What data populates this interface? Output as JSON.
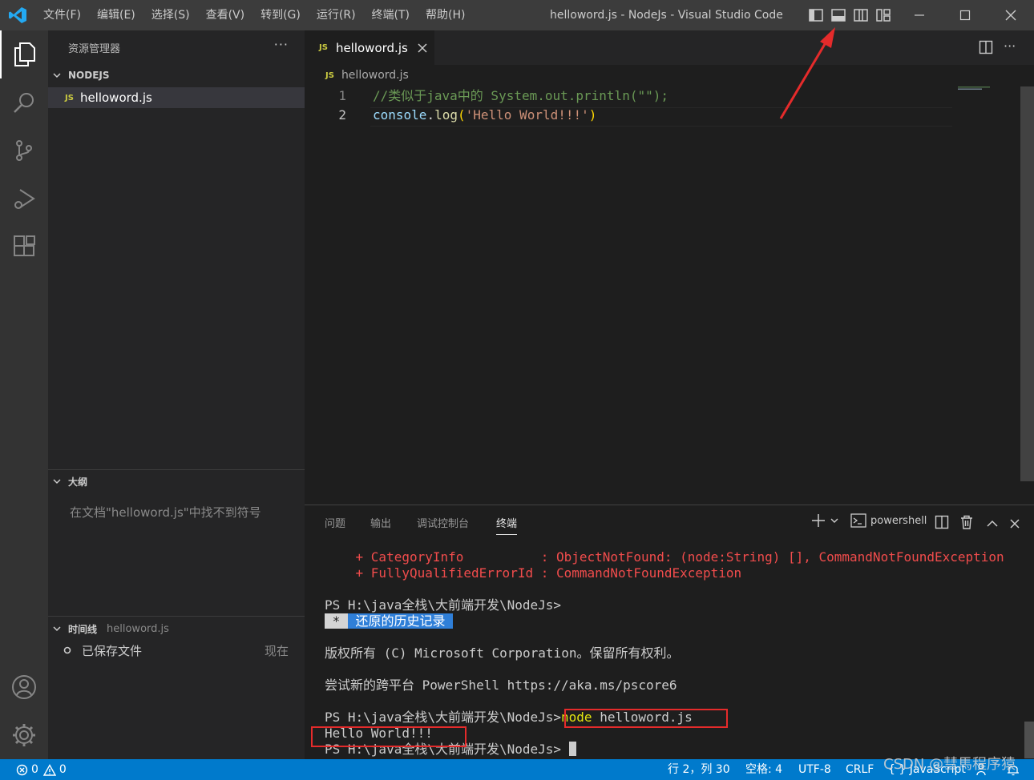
{
  "titlebar": {
    "menu": [
      "文件(F)",
      "编辑(E)",
      "选择(S)",
      "查看(V)",
      "转到(G)",
      "运行(R)",
      "终端(T)",
      "帮助(H)"
    ],
    "title": "helloword.js - NodeJs - Visual Studio Code"
  },
  "sidebar": {
    "title": "资源管理器",
    "more": "···",
    "folder": "NODEJS",
    "file": "helloword.js",
    "file_badge": "JS",
    "outline": {
      "title": "大纲",
      "empty_message": "在文档\"helloword.js\"中找不到符号"
    },
    "timeline": {
      "title": "时间线",
      "file": "helloword.js",
      "entry_label": "已保存文件",
      "entry_time": "现在"
    }
  },
  "editor": {
    "tab_label": "helloword.js",
    "tab_badge": "JS",
    "breadcrumb": "helloword.js",
    "lines": [
      {
        "num": "1",
        "comment": "//类似于java中的 System.out.println(\"\");"
      },
      {
        "num": "2",
        "obj": "console",
        "dot": ".",
        "method": "log",
        "open": "(",
        "str": "'Hello World!!!'",
        "close": ")"
      }
    ]
  },
  "panel": {
    "tabs": [
      "问题",
      "输出",
      "调试控制台",
      "终端"
    ],
    "active_tab": "终端",
    "shell": "powershell",
    "terminal": {
      "err1": "    + CategoryInfo          : ObjectNotFound: (node:String) [], CommandNotFoundException",
      "err2": "    + FullyQualifiedErrorId : CommandNotFoundException",
      "prompt1": "PS H:\\java全栈\\大前端开发\\NodeJs>",
      "restore_star": " * ",
      "restore_text": " 还原的历史记录 ",
      "copyright": "版权所有 (C) Microsoft Corporation。保留所有权利。",
      "pscore": "尝试新的跨平台 PowerShell https://aka.ms/pscore6",
      "prompt2": "PS H:\\java全栈\\大前端开发\\NodeJs>",
      "cmd_node": "node",
      "cmd_rest": " helloword.js",
      "output": "Hello World!!!",
      "prompt3": "PS H:\\java全栈\\大前端开发\\NodeJs>"
    }
  },
  "statusbar": {
    "errors": "0",
    "warnings": "0",
    "position": "行 2，列 30",
    "spaces": "空格: 4",
    "encoding": "UTF-8",
    "eol": "CRLF",
    "language": "JavaScript"
  },
  "watermark": "CSDN @彗馬程序猿",
  "colors": {
    "accent": "#007acc",
    "comment": "#6a9955",
    "variable": "#9cdcfe",
    "function": "#dcdcaa",
    "string": "#ce9178",
    "error": "#f14c4c",
    "highlight_box": "#e52b2b"
  }
}
